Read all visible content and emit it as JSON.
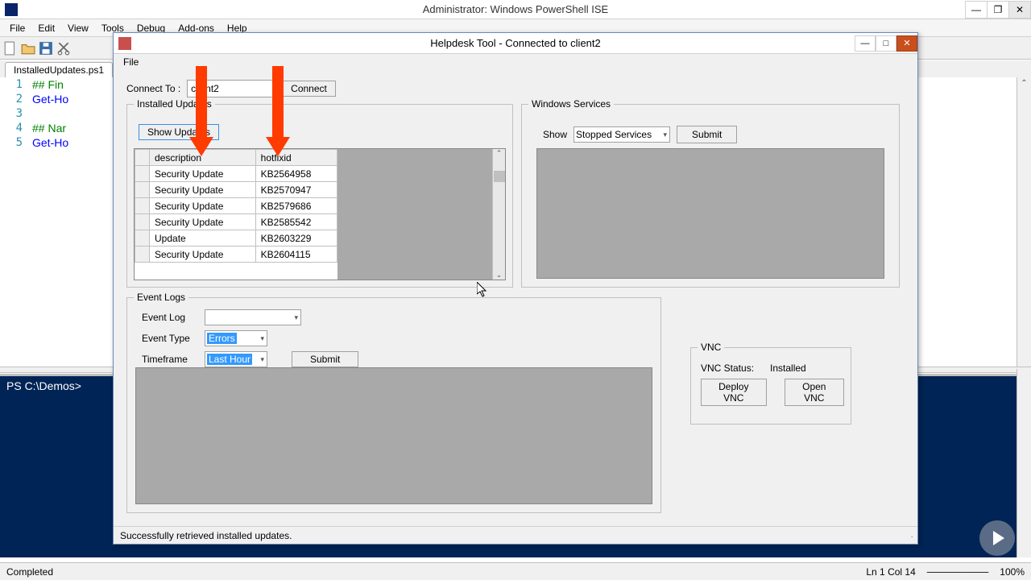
{
  "titlebar": {
    "text": "Administrator: Windows PowerShell ISE"
  },
  "menu": {
    "file": "File",
    "edit": "Edit",
    "view": "View",
    "tools": "Tools",
    "debug": "Debug",
    "addons": "Add-ons",
    "help": "Help"
  },
  "tab": {
    "name": "InstalledUpdates.ps1"
  },
  "editor": {
    "lines": [
      "1",
      "2",
      "3",
      "4",
      "5"
    ],
    "l1": "## Fin",
    "l2": "Get-Ho",
    "l3": "",
    "l4": "## Nar",
    "l5": "Get-Ho"
  },
  "console": {
    "prompt": "PS C:\\Demos>"
  },
  "status": {
    "left": "Completed",
    "pos": "Ln 1  Col 14",
    "zoom": "100%"
  },
  "dialog": {
    "title": "Helpdesk Tool - Connected to client2",
    "menu_file": "File",
    "connect_label": "Connect To :",
    "connect_value": "client2",
    "connect_btn": "Connect",
    "updates": {
      "legend": "Installed Updates",
      "show_btn": "Show Updates",
      "col_desc": "description",
      "col_hotfix": "hotfixid",
      "rows": [
        {
          "desc": "Security Update",
          "hotfix": "KB2564958"
        },
        {
          "desc": "Security Update",
          "hotfix": "KB2570947"
        },
        {
          "desc": "Security Update",
          "hotfix": "KB2579686"
        },
        {
          "desc": "Security Update",
          "hotfix": "KB2585542"
        },
        {
          "desc": "Update",
          "hotfix": "KB2603229"
        },
        {
          "desc": "Security Update",
          "hotfix": "KB2604115"
        }
      ]
    },
    "services": {
      "legend": "Windows Services",
      "show_label": "Show",
      "combo": "Stopped Services",
      "submit": "Submit"
    },
    "eventlogs": {
      "legend": "Event Logs",
      "log_label": "Event Log",
      "type_label": "Event Type",
      "timeframe_label": "Timeframe",
      "type_value": "Errors",
      "timeframe_value": "Last Hour",
      "submit": "Submit"
    },
    "vnc": {
      "legend": "VNC",
      "status_label": "VNC Status:",
      "status_value": "Installed",
      "deploy_btn": "Deploy VNC",
      "open_btn": "Open VNC"
    },
    "status_text": "Successfully retrieved installed updates."
  }
}
